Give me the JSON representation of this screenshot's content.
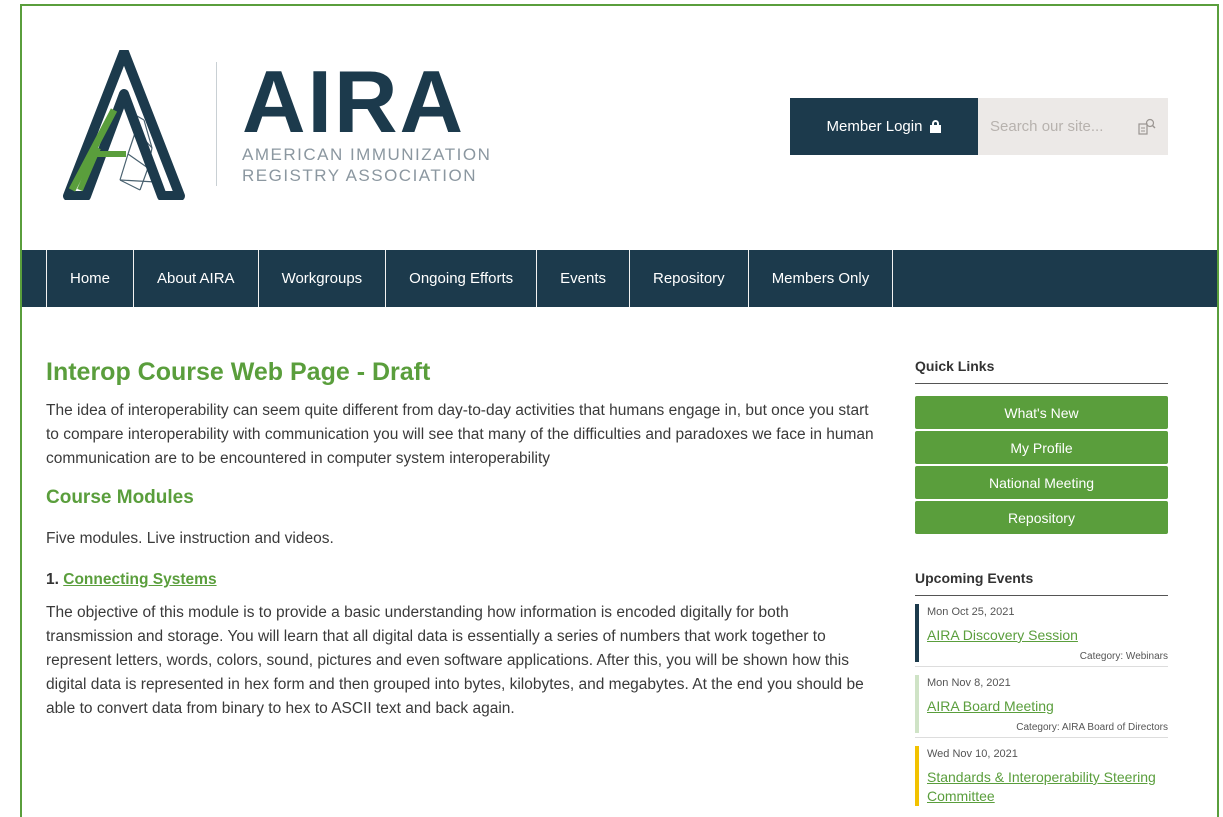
{
  "header": {
    "logo_main": "AIRA",
    "logo_sub_line1": "AMERICAN IMMUNIZATION",
    "logo_sub_line2": "REGISTRY ASSOCIATION",
    "login_label": "Member Login",
    "search_placeholder": "Search our site..."
  },
  "nav": {
    "items": [
      "Home",
      "About AIRA",
      "Workgroups",
      "Ongoing Efforts",
      "Events",
      "Repository",
      "Members Only"
    ]
  },
  "main": {
    "title": "Interop Course Web Page - Draft",
    "intro": "The idea of interoperability can seem quite different from day-to-day activities that humans engage in, but once you start to compare interoperability with communication you will see that many of the difficulties and paradoxes we face in human communication are to be encountered in computer system interoperability",
    "modules_heading": "Course Modules",
    "modules_desc": "Five modules. Live instruction and videos.",
    "module1_number": "1.",
    "module1_link": "Connecting Systems",
    "module1_desc": "The objective of this module is to provide a basic understanding how information is encoded digitally for both transmission and storage. You will learn that all digital data is essentially a series of numbers that work together to represent letters, words, colors, sound, pictures and even software applications. After this, you will be shown how this digital data is represented in hex form and then grouped into bytes, kilobytes, and megabytes. At the end you should be able to convert data from binary to hex to ASCII text and back again."
  },
  "sidebar": {
    "quick_links_heading": "Quick Links",
    "quick_links": [
      "What's New",
      "My Profile",
      "National Meeting",
      "Repository"
    ],
    "events_heading": "Upcoming Events",
    "events": [
      {
        "date": "Mon Oct 25, 2021",
        "title": "AIRA Discovery Session",
        "category": "Category: Webinars",
        "color": "#1c3a4c"
      },
      {
        "date": "Mon Nov 8, 2021",
        "title": "AIRA Board Meeting",
        "category": "Category: AIRA Board of Directors",
        "color": "#cfe3c6"
      },
      {
        "date": "Wed Nov 10, 2021",
        "title": "Standards & Interoperability Steering Committee",
        "category": "",
        "color": "#f2c200"
      }
    ]
  },
  "colors": {
    "brand_navy": "#1c3a4c",
    "brand_green": "#5a9e3c"
  }
}
